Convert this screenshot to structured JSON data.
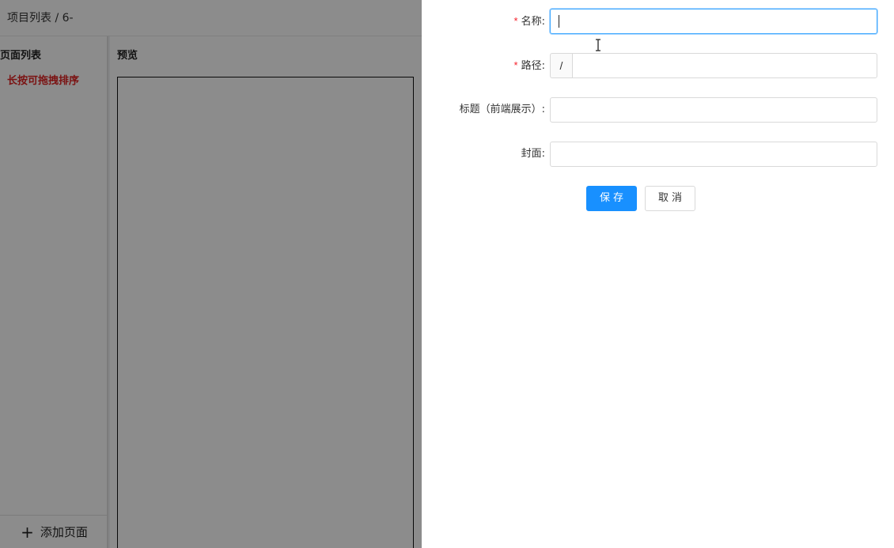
{
  "header": {
    "breadcrumb": "项目列表 / 6-"
  },
  "page_list": {
    "title": "页面列表",
    "hint": "长按可拖拽排序",
    "add_page_label": "添加页面",
    "add_icon": "plus-icon"
  },
  "preview": {
    "title": "预览"
  },
  "form": {
    "name": {
      "label": "名称:",
      "required": "*",
      "value": ""
    },
    "path": {
      "label": "路径:",
      "required": "*",
      "prefix": "/",
      "value": ""
    },
    "title": {
      "label": "标题（前端展示）:",
      "value": ""
    },
    "cover": {
      "label": "封面:",
      "value": ""
    }
  },
  "actions": {
    "save_label": "保存",
    "cancel_label": "取消"
  },
  "colors": {
    "primary": "#1890ff",
    "required": "#f5222d",
    "hint": "#e02424"
  }
}
